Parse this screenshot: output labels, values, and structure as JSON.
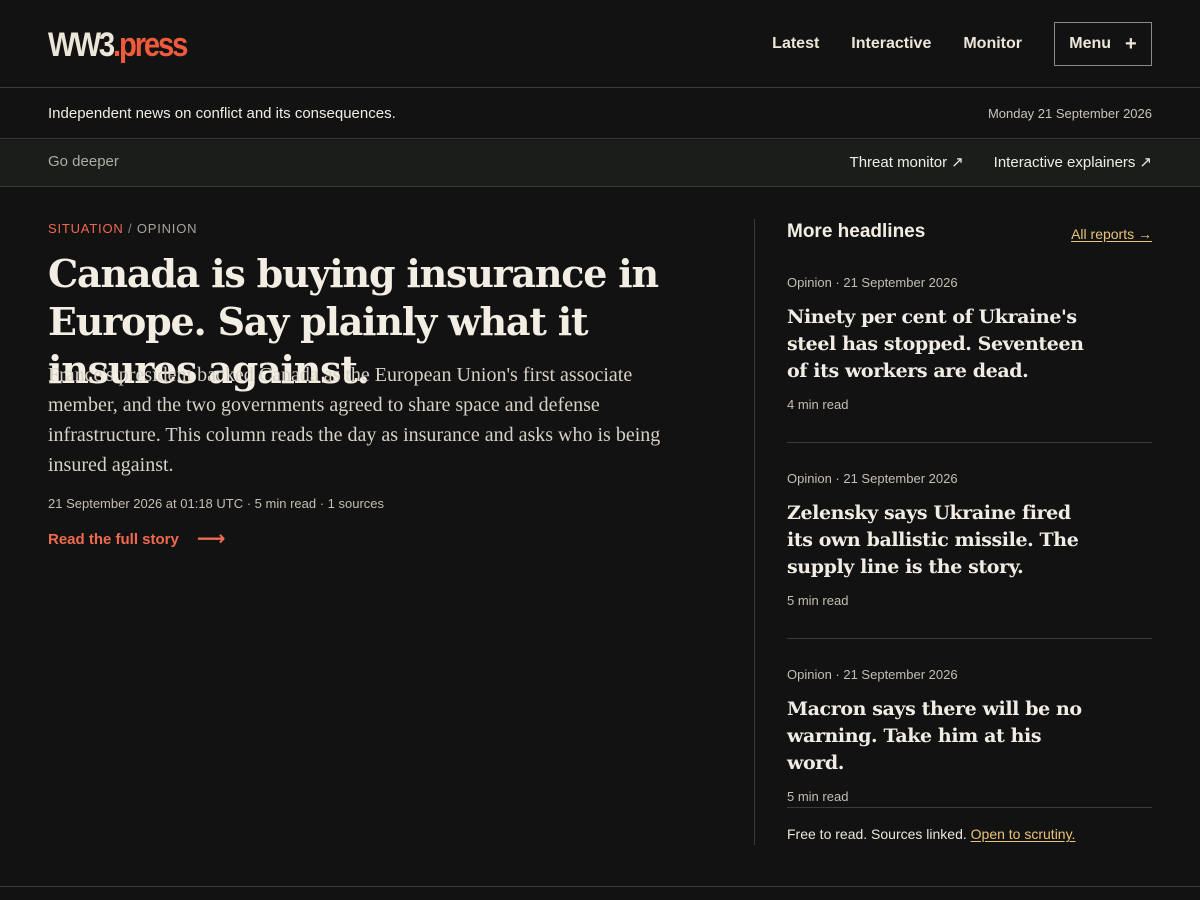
{
  "brand": {
    "logo_part1": "WW3",
    "logo_part2": ".press"
  },
  "nav": {
    "links": [
      "Latest",
      "Interactive",
      "Monitor"
    ],
    "menu_label": "Menu",
    "menu_icon": "+"
  },
  "tagbar": {
    "tagline": "Independent news on conflict and its consequences.",
    "date": "Monday 21 September 2026"
  },
  "deeper": {
    "label": "Go deeper",
    "links": [
      {
        "label": "Threat monitor",
        "icon": "↗"
      },
      {
        "label": "Interactive explainers",
        "icon": "↗"
      }
    ]
  },
  "main_story": {
    "section": "SITUATION",
    "separator": " / ",
    "category": "OPINION",
    "headline": "Canada is buying insurance in Europe. Say plainly what it insures against.",
    "dek": "France's president backed Canada as the European Union's first associate member, and the two governments agreed to share space and defense infrastructure. This column reads the day as insurance and asks who is being insured against.",
    "meta": "21 September 2026 at 01:18 UTC · 5 min read · 1 sources",
    "cta": "Read the full story",
    "cta_icon": "⟶"
  },
  "sidebar": {
    "title": "More headlines",
    "all_reports": "All reports →",
    "stories": [
      {
        "meta": "Opinion · 21 September 2026",
        "title": "Ninety per cent of Ukraine's steel has stopped. Seventeen of its workers are dead.",
        "read": "4 min read"
      },
      {
        "meta": "Opinion · 21 September 2026",
        "title": "Zelensky says Ukraine fired its own ballistic missile. The supply line is the story.",
        "read": "5 min read"
      },
      {
        "meta": "Opinion · 21 September 2026",
        "title": "Macron says there will be no warning. Take him at his word.",
        "read": "5 min read"
      }
    ],
    "footer_text": "Free to read. Sources linked. ",
    "footer_link": "Open to scrutiny."
  },
  "colors": {
    "background": "#121212",
    "accent": "#ef5b3c",
    "link": "#e8c37a",
    "text": "#ece6d9"
  }
}
